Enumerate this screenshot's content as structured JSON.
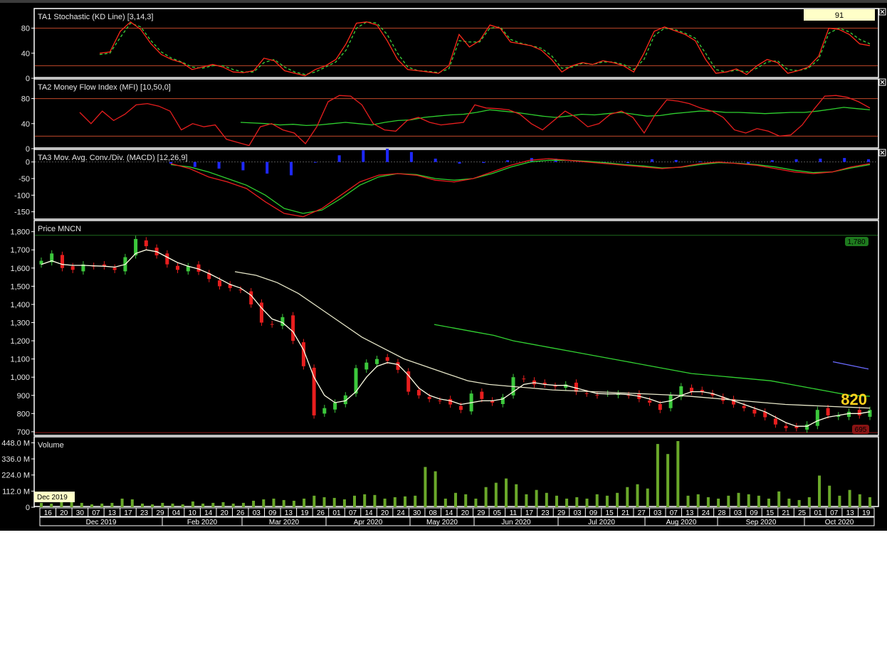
{
  "colors": {
    "background": "#000000",
    "panel_border": "#ffffff",
    "stoch_k": "#ff2a1a",
    "stoch_d": "#3cd23c",
    "level_line": "#c0482a",
    "mfi": "#e81e1e",
    "mfi_signal": "#2fd02f",
    "macd_hist": "#1e28ff",
    "macd": "#e81e1e",
    "macd_signal": "#2fd02f",
    "candle_up": "#3cc83c",
    "candle_down": "#e81e1e",
    "ma_short": "#ffffe6",
    "ma_mid": "#e6e6c8",
    "ma_long": "#32d232",
    "volume": "#6aa82a",
    "last_price_label": "#ffd21e",
    "high_marker": "#1e7a1e",
    "low_marker": "#8a1414"
  },
  "chart_data": [
    {
      "type": "line",
      "title": "TA1 Stochastic (KD Line) [3,14,3]",
      "yticks": [
        "80",
        "40",
        "0"
      ],
      "ylim": [
        0,
        100
      ],
      "levels": [
        80,
        20
      ],
      "current_value": "91",
      "series": [
        {
          "values": [
            40,
            42,
            75,
            90,
            78,
            55,
            38,
            30,
            25,
            14,
            18,
            22,
            18,
            10,
            9,
            12,
            32,
            28,
            12,
            8,
            4,
            14,
            20,
            30,
            55,
            88,
            90,
            85,
            60,
            30,
            14,
            12,
            10,
            8,
            20,
            70,
            50,
            60,
            85,
            80,
            58,
            55,
            52,
            45,
            30,
            10,
            20,
            25,
            22,
            28,
            25,
            20,
            10,
            40,
            75,
            82,
            76,
            70,
            60,
            30,
            8,
            10,
            15,
            6,
            20,
            30,
            25,
            8,
            12,
            18,
            35,
            80,
            78,
            70,
            55,
            52
          ]
        },
        {
          "values": [
            38,
            40,
            65,
            88,
            82,
            60,
            42,
            32,
            26,
            18,
            16,
            20,
            20,
            14,
            10,
            10,
            25,
            30,
            18,
            10,
            6,
            10,
            18,
            26,
            45,
            80,
            90,
            88,
            70,
            40,
            18,
            12,
            11,
            9,
            15,
            60,
            58,
            58,
            80,
            82,
            62,
            56,
            52,
            48,
            36,
            16,
            18,
            24,
            22,
            26,
            26,
            22,
            14,
            30,
            68,
            80,
            78,
            72,
            64,
            40,
            14,
            10,
            13,
            10,
            16,
            26,
            28,
            14,
            12,
            16,
            30,
            72,
            80,
            74,
            62,
            55
          ]
        }
      ]
    },
    {
      "type": "line",
      "title": "TA2 Money Flow Index (MFI) [10,50,0]",
      "yticks": [
        "80",
        "40",
        "0"
      ],
      "ylim": [
        0,
        100
      ],
      "levels": [
        80,
        20
      ],
      "series": [
        {
          "values": [
            58,
            40,
            60,
            45,
            55,
            70,
            72,
            68,
            60,
            30,
            40,
            35,
            38,
            15,
            10,
            5,
            35,
            40,
            30,
            25,
            8,
            35,
            75,
            85,
            84,
            70,
            40,
            30,
            28,
            45,
            50,
            42,
            38,
            40,
            42,
            70,
            65,
            64,
            62,
            55,
            40,
            30,
            45,
            60,
            50,
            35,
            40,
            55,
            60,
            50,
            25,
            55,
            78,
            76,
            72,
            65,
            60,
            50,
            30,
            25,
            32,
            28,
            20,
            22,
            38,
            62,
            84,
            85,
            82,
            75,
            65
          ]
        },
        {
          "values": [
            42,
            41,
            40,
            38,
            39,
            37,
            38,
            40,
            42,
            40,
            38,
            42,
            45,
            46,
            50,
            52,
            54,
            55,
            58,
            62,
            60,
            58,
            55,
            52,
            50,
            52,
            55,
            54,
            56,
            58,
            55,
            52,
            53,
            56,
            58,
            60,
            60,
            58,
            58,
            57,
            56,
            57,
            58,
            58,
            60,
            63,
            66,
            64,
            62
          ]
        }
      ]
    },
    {
      "type": "line",
      "title": "TA3 Mov. Avg. Conv./Div. (MACD) [12,26,9]",
      "yticks": [
        "0",
        "-50",
        "-100",
        "-150"
      ],
      "ylim": [
        -170,
        25
      ],
      "series": [
        {
          "values": [
            -5,
            -20,
            -45,
            -60,
            -80,
            -120,
            -155,
            -165,
            -140,
            -100,
            -60,
            -40,
            -35,
            -40,
            -55,
            -60,
            -50,
            -30,
            -10,
            5,
            10,
            5,
            0,
            -5,
            -10,
            -15,
            -20,
            -15,
            -5,
            0,
            -5,
            -10,
            -20,
            -30,
            -35,
            -30,
            -15,
            -5
          ]
        },
        {
          "values": [
            -8,
            -15,
            -30,
            -50,
            -70,
            -100,
            -140,
            -155,
            -145,
            -110,
            -70,
            -45,
            -35,
            -38,
            -50,
            -55,
            -50,
            -35,
            -15,
            0,
            5,
            5,
            2,
            -2,
            -8,
            -12,
            -18,
            -16,
            -8,
            -2,
            -4,
            -8,
            -15,
            -25,
            -32,
            -30,
            -18,
            -8
          ]
        },
        {
          "values": [
            -5,
            -15,
            -20,
            -25,
            -35,
            -40,
            0,
            20,
            35,
            40,
            30,
            10,
            -5,
            -3,
            5,
            12,
            10,
            2,
            -5,
            -3,
            8,
            6,
            2,
            -3,
            -5,
            5,
            8,
            10,
            12,
            8
          ]
        }
      ]
    },
    {
      "type": "candlestick",
      "title": "Price MNCN",
      "yticks": [
        "1,800",
        "1,700",
        "1,600",
        "1,500",
        "1,400",
        "1,300",
        "1,200",
        "1,100",
        "1,000",
        "900",
        "800",
        "700"
      ],
      "ylim": [
        680,
        1830
      ],
      "high_marker": "1,780",
      "low_marker": "695",
      "last_price": "820",
      "close": [
        1640,
        1680,
        1600,
        1590,
        1620,
        1610,
        1610,
        1590,
        1660,
        1760,
        1720,
        1670,
        1620,
        1590,
        1610,
        1580,
        1540,
        1500,
        1490,
        1480,
        1400,
        1300,
        1290,
        1330,
        1200,
        1060,
        790,
        830,
        860,
        900,
        1050,
        1080,
        1100,
        1090,
        1040,
        920,
        900,
        880,
        870,
        850,
        820,
        910,
        880,
        860,
        890,
        1000,
        990,
        960,
        960,
        950,
        960,
        920,
        910,
        900,
        910,
        910,
        900,
        880,
        860,
        820,
        900,
        950,
        920,
        920,
        900,
        870,
        850,
        830,
        800,
        780,
        740,
        720,
        720,
        740,
        820,
        790,
        790,
        810,
        790,
        820
      ],
      "ma_short": [
        1620,
        1640,
        1620,
        1615,
        1615,
        1612,
        1610,
        1605,
        1620,
        1680,
        1700,
        1690,
        1660,
        1630,
        1610,
        1595,
        1570,
        1540,
        1510,
        1490,
        1450,
        1380,
        1320,
        1300,
        1250,
        1150,
        1000,
        900,
        860,
        870,
        920,
        1000,
        1060,
        1080,
        1070,
        1010,
        940,
        900,
        880,
        870,
        850,
        860,
        870,
        870,
        880,
        920,
        960,
        970,
        960,
        955,
        955,
        940,
        925,
        910,
        908,
        908,
        904,
        895,
        880,
        860,
        870,
        900,
        920,
        920,
        910,
        890,
        870,
        850,
        830,
        810,
        780,
        750,
        730,
        730,
        760,
        780,
        790,
        800,
        800,
        810
      ],
      "ma_mid": [
        1580,
        1560,
        1520,
        1460,
        1380,
        1300,
        1220,
        1160,
        1100,
        1060,
        1020,
        980,
        960,
        950,
        940,
        930,
        925,
        920,
        915,
        910,
        905,
        900,
        890,
        880,
        870,
        860,
        850,
        845,
        840,
        835,
        830
      ],
      "ma_long": [
        1290,
        1270,
        1250,
        1230,
        1200,
        1180,
        1160,
        1140,
        1120,
        1100,
        1080,
        1060,
        1040,
        1020,
        1010,
        1000,
        990,
        980,
        960,
        940,
        920,
        900,
        895
      ],
      "trendline": [
        1085,
        1045
      ]
    },
    {
      "type": "bar",
      "title": "Volume",
      "yticks": [
        "448.0 M",
        "336.0 M",
        "224.0 M",
        "112.0 M",
        "0"
      ],
      "ylim": [
        0,
        470
      ],
      "tooltip": "Dec 2019",
      "values": [
        30,
        25,
        35,
        40,
        30,
        20,
        25,
        30,
        60,
        55,
        25,
        20,
        30,
        25,
        20,
        40,
        25,
        30,
        35,
        25,
        30,
        45,
        55,
        60,
        50,
        45,
        60,
        80,
        70,
        65,
        55,
        80,
        90,
        85,
        60,
        70,
        75,
        80,
        280,
        250,
        60,
        100,
        90,
        60,
        140,
        170,
        200,
        160,
        90,
        120,
        100,
        80,
        60,
        70,
        60,
        90,
        80,
        100,
        140,
        160,
        130,
        440,
        370,
        460,
        80,
        90,
        70,
        60,
        80,
        100,
        90,
        80,
        60,
        110,
        60,
        50,
        70,
        220,
        150,
        80,
        120,
        90,
        70
      ]
    }
  ],
  "x_axis": {
    "day_labels": [
      "16",
      "20",
      "30",
      "07",
      "13",
      "17",
      "23",
      "29",
      "04",
      "10",
      "14",
      "20",
      "26",
      "03",
      "09",
      "13",
      "19",
      "26",
      "01",
      "07",
      "14",
      "20",
      "24",
      "30",
      "08",
      "14",
      "20",
      "29",
      "05",
      "11",
      "17",
      "23",
      "29",
      "03",
      "09",
      "15",
      "21",
      "27",
      "03",
      "07",
      "13",
      "24",
      "28",
      "03",
      "09",
      "15",
      "21",
      "25",
      "01",
      "07",
      "13",
      "19"
    ],
    "month_labels": [
      "Dec 2019",
      "Feb 2020",
      "Mar 2020",
      "Apr 2020",
      "May 2020",
      "Jun 2020",
      "Jul 2020",
      "Aug 2020",
      "Sep 2020",
      "Oct 2020"
    ]
  }
}
